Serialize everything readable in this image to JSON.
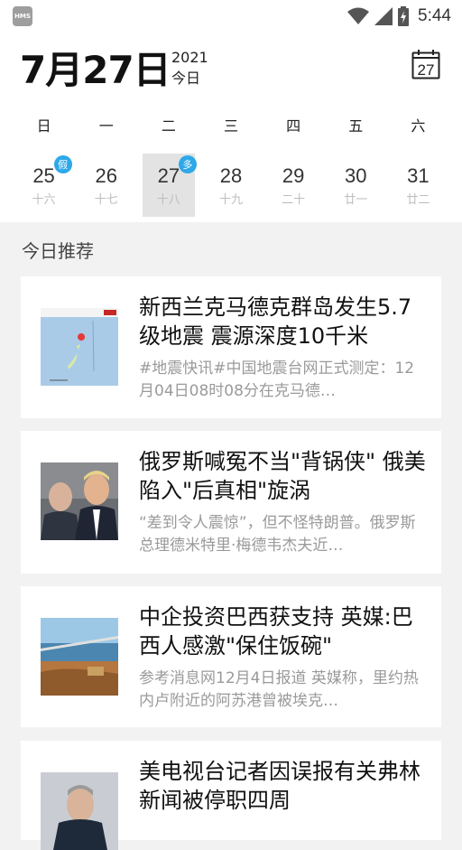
{
  "status_bar": {
    "app_badge": "HMS",
    "time": "5:44"
  },
  "header": {
    "date": "7月27日",
    "year": "2021",
    "today_label": "今日",
    "calendar_icon_day": "27"
  },
  "week": {
    "weekdays": [
      "日",
      "一",
      "二",
      "三",
      "四",
      "五",
      "六"
    ],
    "days": [
      {
        "num": "25",
        "lunar": "十六",
        "badge": "假"
      },
      {
        "num": "26",
        "lunar": "十七",
        "badge": ""
      },
      {
        "num": "27",
        "lunar": "十八",
        "badge": "多"
      },
      {
        "num": "28",
        "lunar": "十九",
        "badge": ""
      },
      {
        "num": "29",
        "lunar": "二十",
        "badge": ""
      },
      {
        "num": "30",
        "lunar": "廿一",
        "badge": ""
      },
      {
        "num": "31",
        "lunar": "廿二",
        "badge": ""
      }
    ]
  },
  "recommend": {
    "section_title": "今日推荐",
    "articles": [
      {
        "title": "新西兰克马德克群岛发生5.7级地震 震源深度10千米",
        "desc": "#地震快讯#中国地震台网正式测定：12月04日08时08分在克马德…"
      },
      {
        "title": "俄罗斯喊冤不当\"背锅侠\" 俄美陷入\"后真相\"旋涡",
        "desc": "“差到令人震惊”，但不怪特朗普。俄罗斯总理德米特里·梅德韦杰夫近…"
      },
      {
        "title": "中企投资巴西获支持 英媒:巴西人感激\"保住饭碗\"",
        "desc": "参考消息网12月4日报道 英媒称，里约热内卢附近的阿苏港曾被埃克…"
      },
      {
        "title": "美电视台记者因误报有关弗林新闻被停职四周",
        "desc": ""
      }
    ]
  },
  "colors": {
    "accent_badge": "#2ea8e8",
    "selected_day_bg": "#e3e3e3",
    "page_bg": "#f2f2f2"
  }
}
